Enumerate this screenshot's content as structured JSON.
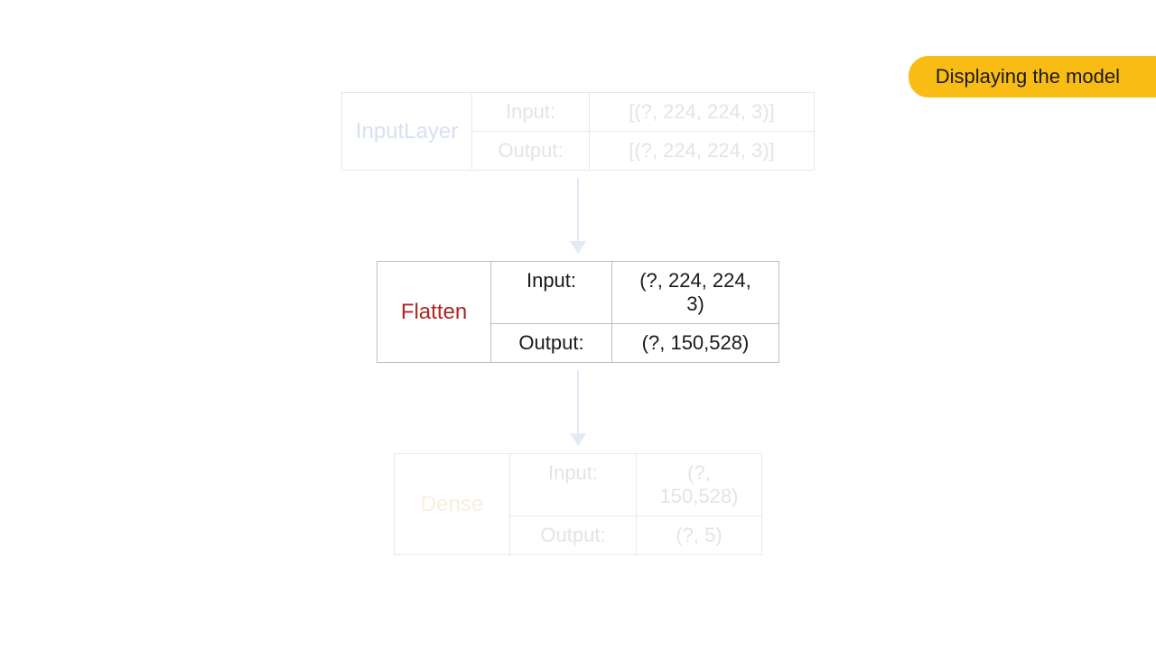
{
  "banner": {
    "title": "Displaying the model"
  },
  "layers": [
    {
      "name": "InputLayer",
      "input_label": "Input:",
      "input_value": "[(?, 224, 224, 3)]",
      "output_label": "Output:",
      "output_value": "[(?, 224, 224, 3)]"
    },
    {
      "name": "Flatten",
      "input_label": "Input:",
      "input_value": "(?, 224, 224, 3)",
      "output_label": "Output:",
      "output_value": "(?, 150,528)"
    },
    {
      "name": "Dense",
      "input_label": "Input:",
      "input_value": "(?, 150,528)",
      "output_label": "Output:",
      "output_value": "(?, 5)"
    }
  ]
}
